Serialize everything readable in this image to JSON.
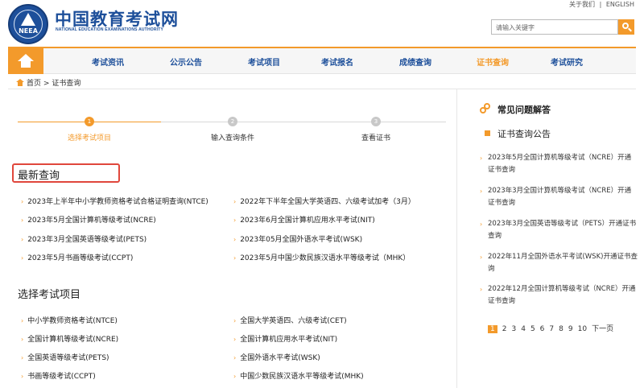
{
  "header": {
    "logo_text": "NEEA",
    "site_title": "中国教育考试网",
    "site_subtitle": "NATIONAL EDUCATION EXAMINATIONS AUTHORITY",
    "links": [
      "关于我们",
      "|",
      "ENGLISH"
    ],
    "search_placeholder": "请输入关键字"
  },
  "nav": {
    "items": [
      "考试资讯",
      "公示公告",
      "考试项目",
      "考试报名",
      "成绩查询",
      "证书查询",
      "考试研究"
    ],
    "active": "证书查询"
  },
  "breadcrumb": {
    "home": "首页",
    "separator": ">",
    "current": "证书查询"
  },
  "steps": [
    {
      "num": "1",
      "label": "选择考试项目",
      "active": true
    },
    {
      "num": "2",
      "label": "输入查询条件",
      "active": false
    },
    {
      "num": "3",
      "label": "查看证书",
      "active": false
    }
  ],
  "recent": {
    "title": "最新查询",
    "left": [
      "2023年上半年中小学教师资格考试合格证明查询(NTCE)",
      "2023年5月全国计算机等级考试(NCRE)",
      "2023年3月全国英语等级考试(PETS)",
      "2023年5月书画等级考试(CCPT)"
    ],
    "right": [
      "2022年下半年全国大学英语四、六级考试加考（3月）",
      "2023年6月全国计算机应用水平考试(NIT)",
      "2023年05月全国外语水平考试(WSK)",
      "2023年5月中国少数民族汉语水平等级考试（MHK）"
    ]
  },
  "select": {
    "title": "选择考试项目",
    "left": [
      "中小学教师资格考试(NTCE)",
      "全国计算机等级考试(NCRE)",
      "全国英语等级考试(PETS)",
      "书画等级考试(CCPT)"
    ],
    "right": [
      "全国大学英语四、六级考试(CET)",
      "全国计算机应用水平考试(NIT)",
      "全国外语水平考试(WSK)",
      "中国少数民族汉语水平等级考试(MHK)"
    ]
  },
  "sidebar": {
    "faq_title": "常见问题解答",
    "notice_title": "证书查询公告",
    "notices": [
      "2023年5月全国计算机等级考试（NCRE）开通证书查询",
      "2023年3月全国计算机等级考试（NCRE）开通证书查询",
      "2023年3月全国英语等级考试（PETS）开通证书查询",
      "2022年11月全国外语水平考试(WSK)开通证书查询",
      "2022年12月全国计算机等级考试（NCRE）开通证书查询"
    ],
    "pager": {
      "current": "1",
      "pages": [
        "2",
        "3",
        "4",
        "5",
        "6",
        "7",
        "8",
        "9",
        "10"
      ],
      "next": "下一页"
    }
  },
  "colors": {
    "accent": "#f39a2b",
    "brand": "#1d4f9a",
    "highlight": "#e0473c"
  }
}
